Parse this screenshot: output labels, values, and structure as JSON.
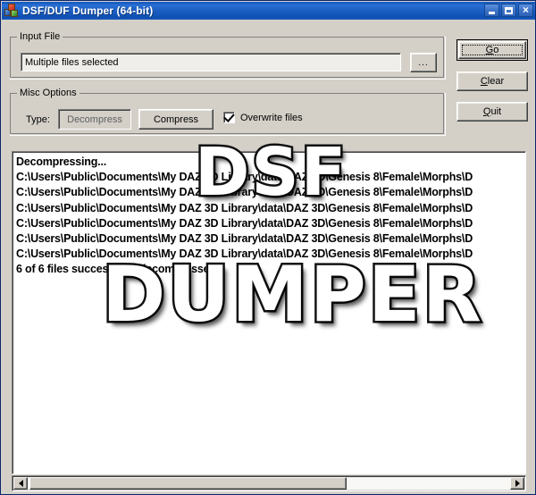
{
  "window": {
    "title": "DSF/DUF Dumper (64-bit)",
    "icon": "app-cubes-icon",
    "caption_buttons": {
      "minimize": "minimize-icon",
      "maximize": "maximize-icon",
      "close": "×"
    },
    "accent_titlebar": "#1f63c8",
    "face_color": "#d4d0c8"
  },
  "input_group": {
    "label": "Input File",
    "file_field_value": "Multiple files selected",
    "file_field_placeholder": "",
    "browse_label": "..."
  },
  "misc_group": {
    "label": "Misc Options",
    "type_label": "Type:",
    "decompress_label": "Decompress",
    "compress_label": "Compress",
    "overwrite_label": "Overwrite files",
    "overwrite_checked": true,
    "selected_type": "Decompress"
  },
  "actions": {
    "go": {
      "prefix": "",
      "accel": "G",
      "suffix": "o",
      "full": "Go"
    },
    "clear": {
      "prefix": "",
      "accel": "C",
      "suffix": "lear",
      "full": "Clear"
    },
    "quit": {
      "prefix": "",
      "accel": "Q",
      "suffix": "uit",
      "full": "Quit"
    }
  },
  "log": {
    "lines": [
      "Decompressing...",
      "C:\\Users\\Public\\Documents\\My DAZ 3D Library\\data\\DAZ 3D\\Genesis 8\\Female\\Morphs\\D",
      "C:\\Users\\Public\\Documents\\My DAZ 3D Library\\data\\DAZ 3D\\Genesis 8\\Female\\Morphs\\D",
      "C:\\Users\\Public\\Documents\\My DAZ 3D Library\\data\\DAZ 3D\\Genesis 8\\Female\\Morphs\\D",
      "C:\\Users\\Public\\Documents\\My DAZ 3D Library\\data\\DAZ 3D\\Genesis 8\\Female\\Morphs\\D",
      "C:\\Users\\Public\\Documents\\My DAZ 3D Library\\data\\DAZ 3D\\Genesis 8\\Female\\Morphs\\D",
      "C:\\Users\\Public\\Documents\\My DAZ 3D Library\\data\\DAZ 3D\\Genesis 8\\Female\\Morphs\\D",
      "6 of 6 files successfully decompressed"
    ]
  },
  "scrollbar": {
    "left_arrow": "scroll-left-icon",
    "right_arrow": "scroll-right-icon",
    "thumb_fraction": 0.62
  },
  "watermark": {
    "line1": "DSF",
    "line2": "DUMPER"
  }
}
